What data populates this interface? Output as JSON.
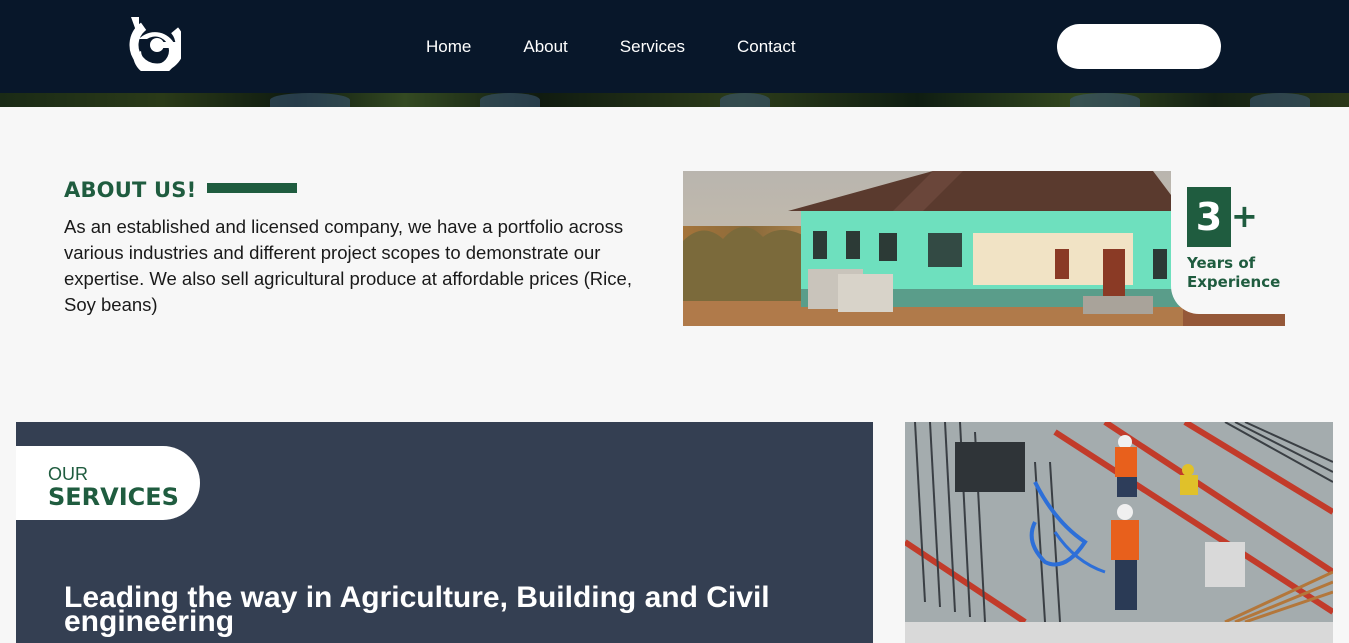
{
  "header": {
    "nav": [
      "Home",
      "About",
      "Services",
      "Contact"
    ],
    "cta_label": ""
  },
  "about": {
    "heading": "ABOUT US!",
    "text": "As an established and licensed company, we have a portfolio across various industries and different project scopes to demonstrate our expertise. We also sell agricultural produce at affordable prices (Rice, Soy beans)",
    "experience_number": "3",
    "experience_plus": "+",
    "experience_label_line1": "Years of",
    "experience_label_line2": "Experience"
  },
  "services": {
    "tag_small": "OUR",
    "tag_big": "SERVICES",
    "headline": "Leading the way in Agriculture, Building and Civil engineering"
  },
  "colors": {
    "header_bg": "#08172a",
    "brand_green": "#1f5c3f",
    "services_panel": "#343f52",
    "page_bg": "#f7f7f7"
  },
  "icons": {
    "logo": "company-logo-icon"
  }
}
